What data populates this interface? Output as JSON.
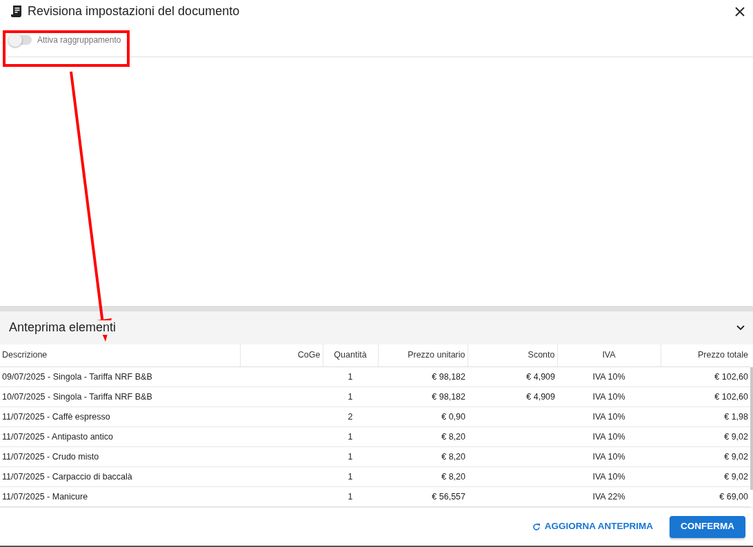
{
  "dialog": {
    "title": "Revisiona impostazioni del documento"
  },
  "grouping_toggle": {
    "label": "Attiva raggruppamento",
    "on": false
  },
  "preview": {
    "title": "Anteprima elementi",
    "expanded": true,
    "columns": [
      {
        "label": "Descrizione"
      },
      {
        "label": "CoGe"
      },
      {
        "label": "Quantità"
      },
      {
        "label": "Prezzo unitario"
      },
      {
        "label": "Sconto"
      },
      {
        "label": "IVA"
      },
      {
        "label": "Prezzo totale"
      }
    ],
    "rows": [
      {
        "description": "09/07/2025 - Singola - Tariffa NRF B&B",
        "quantity": "1",
        "unit_price": "€ 98,182",
        "discount": "€ 4,909",
        "vat": "IVA 10%",
        "total": "€ 102,60"
      },
      {
        "description": "10/07/2025 - Singola - Tariffa NRF B&B",
        "quantity": "1",
        "unit_price": "€ 98,182",
        "discount": "€ 4,909",
        "vat": "IVA 10%",
        "total": "€ 102,60"
      },
      {
        "description": "11/07/2025 - Caffè espresso",
        "quantity": "2",
        "unit_price": "€ 0,90",
        "vat": "IVA 10%",
        "total": "€ 1,98"
      },
      {
        "description": "11/07/2025 - Antipasto antico",
        "quantity": "1",
        "unit_price": "€ 8,20",
        "vat": "IVA 10%",
        "total": "€ 9,02"
      },
      {
        "description": "11/07/2025 - Crudo misto",
        "quantity": "1",
        "unit_price": "€ 8,20",
        "vat": "IVA 10%",
        "total": "€ 9,02"
      },
      {
        "description": "11/07/2025 - Carpaccio di baccalà",
        "quantity": "1",
        "unit_price": "€ 8,20",
        "vat": "IVA 10%",
        "total": "€ 9,02"
      },
      {
        "description": "11/07/2025 - Manicure",
        "quantity": "1",
        "unit_price": "€ 56,557",
        "vat": "IVA 22%",
        "total": "€ 69,00"
      }
    ]
  },
  "footer": {
    "refresh_button": "AGGIORNA ANTEPRIMA",
    "confirm_button": "CONFERMA"
  }
}
